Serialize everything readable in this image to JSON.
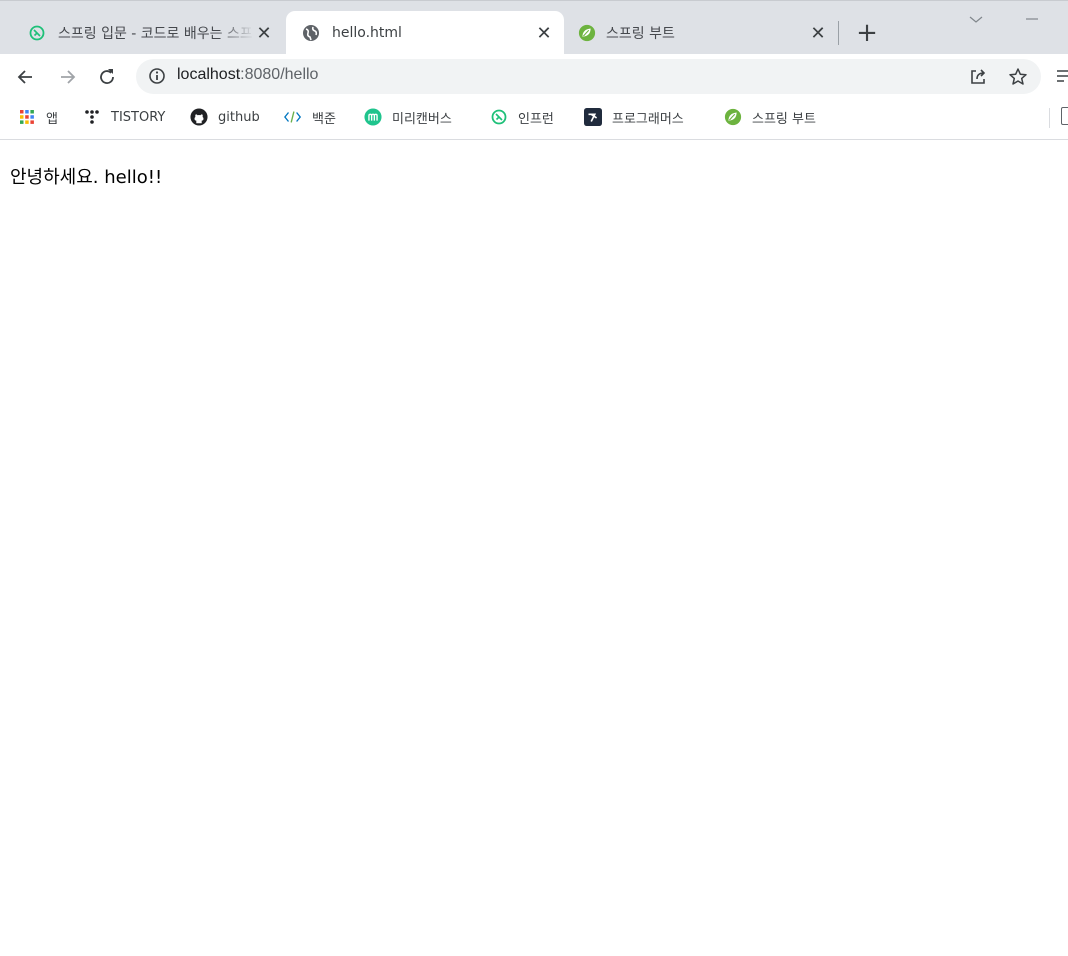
{
  "browser": {
    "tabs": [
      {
        "title": "스프링 입문 - 코드로 배우는 스프링 부트",
        "favicon": "inflearn-icon",
        "active": false
      },
      {
        "title": "hello.html",
        "favicon": "globe-icon",
        "active": true
      },
      {
        "title": "스프링 부트",
        "favicon": "spring-leaf-icon",
        "active": false
      }
    ],
    "new_tab_label": "+",
    "close_glyph": "✕"
  },
  "toolbar": {
    "url_host": "localhost",
    "url_rest": ":8080/hello"
  },
  "bookmarks": [
    {
      "label": "앱",
      "icon": "apps-grid-icon"
    },
    {
      "label": "TISTORY",
      "icon": "tistory-icon"
    },
    {
      "label": "github",
      "icon": "github-icon"
    },
    {
      "label": "백준",
      "icon": "code-brackets-icon"
    },
    {
      "label": "미리캔버스",
      "icon": "miricanvas-icon"
    },
    {
      "label": "인프런",
      "icon": "inflearn-icon"
    },
    {
      "label": "프로그래머스",
      "icon": "programmers-icon"
    },
    {
      "label": "스프링 부트",
      "icon": "spring-leaf-icon"
    }
  ],
  "page": {
    "greeting": "안녕하세요. hello!!"
  },
  "colors": {
    "tabstrip_bg": "#dee1e6",
    "omnibox_bg": "#f1f3f4",
    "inflearn_green": "#1dc078",
    "spring_green": "#6db33f",
    "miri_green": "#1fc48d"
  }
}
